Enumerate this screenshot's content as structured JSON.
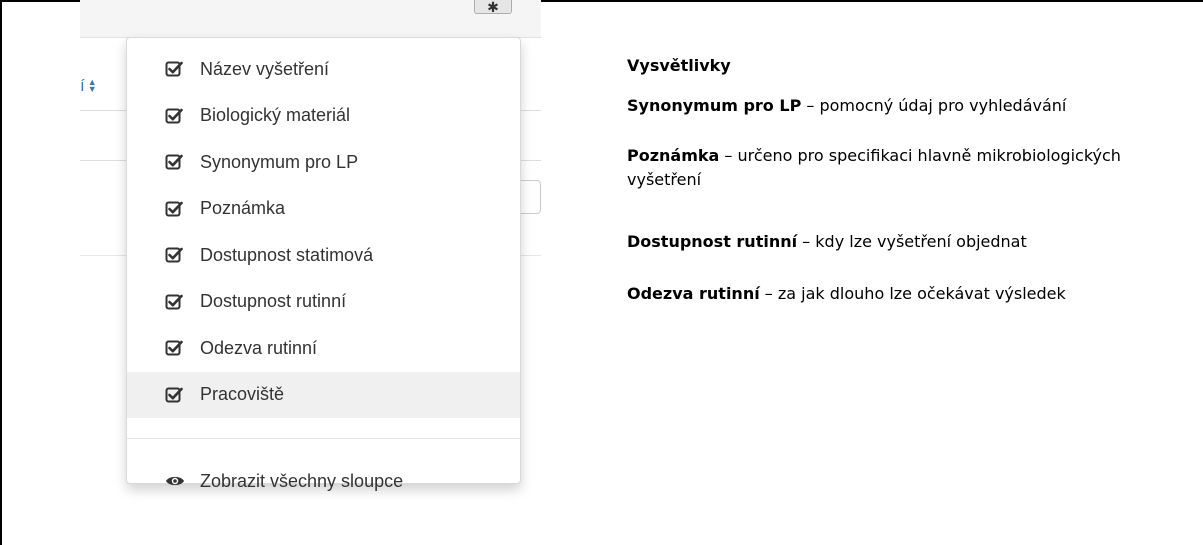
{
  "toolbar": {
    "gear_icon": "gear-icon"
  },
  "table": {
    "header_fragment": "í"
  },
  "column_menu": {
    "items": [
      {
        "label": "Název vyšetření",
        "checked": true
      },
      {
        "label": "Biologický materiál",
        "checked": true
      },
      {
        "label": "Synonymum pro LP",
        "checked": true
      },
      {
        "label": "Poznámka",
        "checked": true
      },
      {
        "label": "Dostupnost statimová",
        "checked": true
      },
      {
        "label": "Dostupnost rutinní",
        "checked": true
      },
      {
        "label": "Odezva rutinní",
        "checked": true
      },
      {
        "label": "Pracoviště",
        "checked": true,
        "highlighted": true
      }
    ],
    "show_all_label": "Zobrazit všechny sloupce"
  },
  "legend": {
    "heading": "Vysvětlivky",
    "entries": [
      {
        "term": "Synonymum pro LP",
        "text": " – pomocný údaj pro vyhledávání"
      },
      {
        "term": "Poznámka",
        "text": " – určeno pro specifikaci hlavně mikrobiologických vyšetření"
      },
      {
        "term": "Dostupnost rutinní",
        "text": " – kdy lze vyšetření objednat"
      },
      {
        "term": "Odezva rutinní",
        "text": " – za jak dlouho lze očekávat výsledek"
      }
    ]
  },
  "colors": {
    "link": "#337ab7",
    "menu_text": "#333333",
    "highlight": "#f0f0f0"
  }
}
